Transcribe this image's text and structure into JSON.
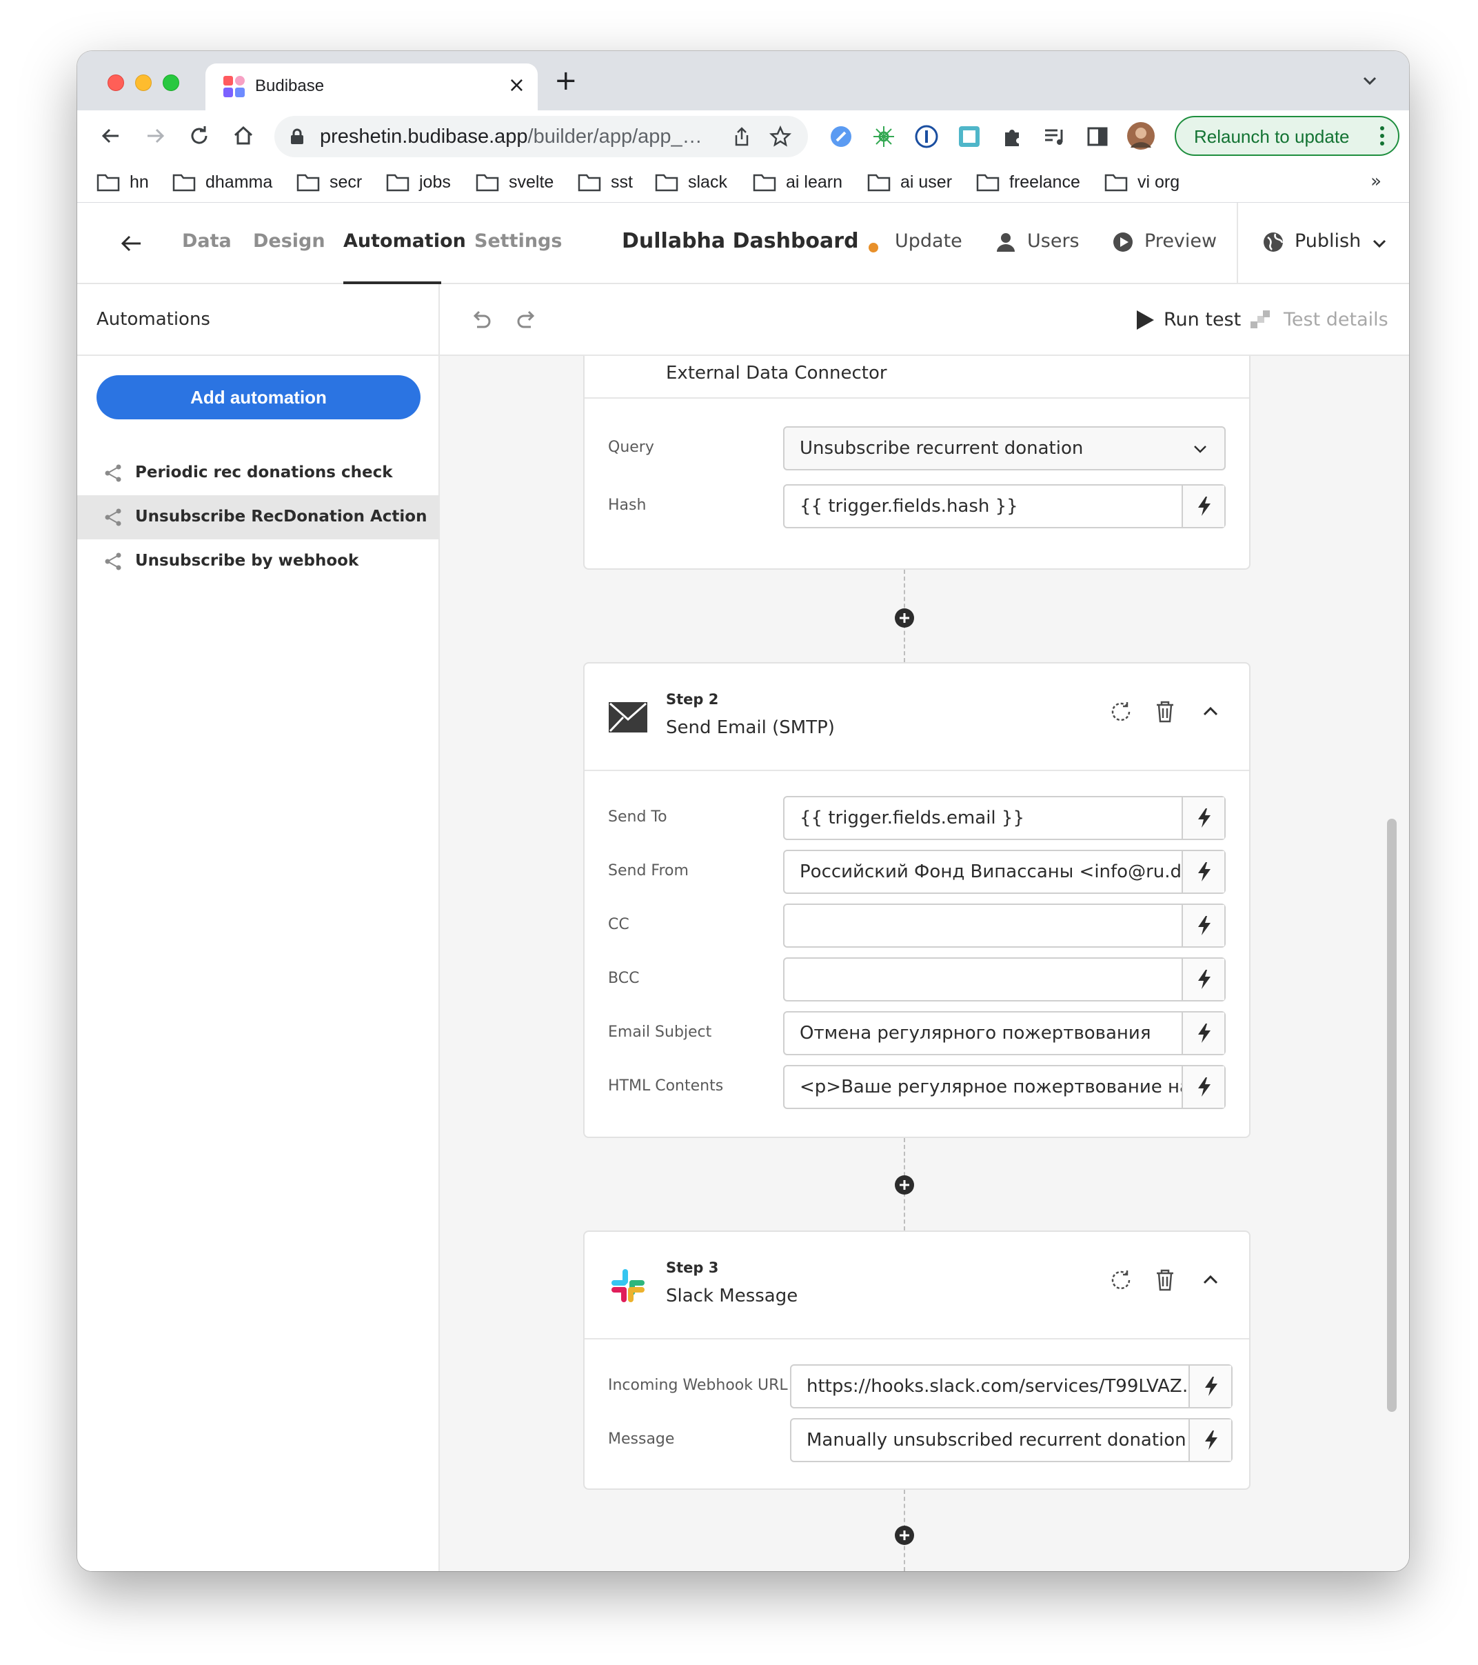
{
  "browser": {
    "tab_title": "Budibase",
    "tab_close": "×",
    "new_tab": "+",
    "url_host": "preshetin.budibase.app",
    "url_path": "/builder/app/app_…",
    "relaunch_label": "Relaunch to update",
    "bookmarks": [
      "hn",
      "dhamma",
      "secr",
      "jobs",
      "svelte",
      "sst",
      "slack",
      "ai learn",
      "ai user",
      "freelance",
      "vi org"
    ],
    "bookmarks_more": "»"
  },
  "nav": {
    "tabs": [
      "Data",
      "Design",
      "Automation",
      "Settings"
    ],
    "active_tab": "Automation",
    "app_title": "Dullabha Dashboard",
    "update": "Update",
    "users": "Users",
    "preview": "Preview",
    "publish": "Publish"
  },
  "sidebar": {
    "title": "Automations",
    "add_button": "Add automation",
    "items": [
      {
        "label": "Periodic rec donations check"
      },
      {
        "label": "Unsubscribe RecDonation Action"
      },
      {
        "label": "Unsubscribe by webhook"
      }
    ]
  },
  "canvas_toolbar": {
    "run_test": "Run test",
    "test_details": "Test details"
  },
  "step1": {
    "partial_title": "External Data Connector",
    "fields": [
      {
        "label": "Query",
        "value": "Unsubscribe recurrent donation"
      },
      {
        "label": "Hash",
        "value": "{{ trigger.fields.hash }}"
      }
    ]
  },
  "step2": {
    "step_label": "Step 2",
    "name": "Send Email (SMTP)",
    "fields": [
      {
        "label": "Send To",
        "value": "{{ trigger.fields.email }}"
      },
      {
        "label": "Send From",
        "value": "Российский Фонд Випассаны <info@ru.d…"
      },
      {
        "label": "CC",
        "value": ""
      },
      {
        "label": "BCC",
        "value": ""
      },
      {
        "label": "Email Subject",
        "value": "Отмена регулярного пожертвования"
      },
      {
        "label": "HTML Contents",
        "value": "<p>Ваше регулярное пожертвование на …"
      }
    ]
  },
  "step3": {
    "step_label": "Step 3",
    "name": "Slack Message",
    "fields": [
      {
        "label": "Incoming Webhook URL",
        "value": "https://hooks.slack.com/services/T99LVAZ…"
      },
      {
        "label": "Message",
        "value": "Manually unsubscribed recurrent donation …"
      }
    ]
  },
  "colors": {
    "primary_button": "#2b74e2",
    "update_dot": "#e8902a",
    "relaunch_green": "#137333"
  }
}
